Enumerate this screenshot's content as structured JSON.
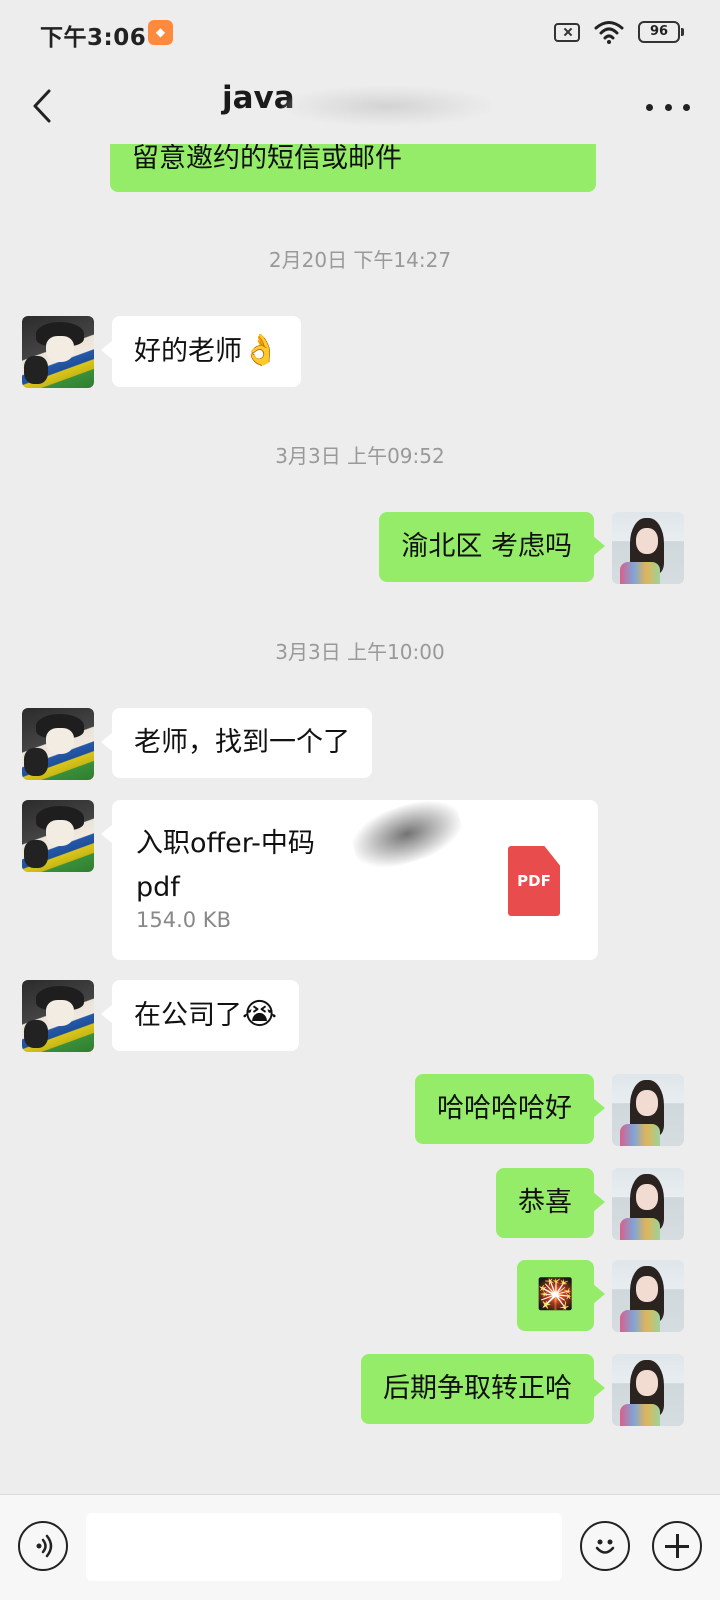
{
  "status_bar": {
    "time": "下午3:06",
    "battery": "96",
    "icons": [
      "app-notification-icon",
      "no-sim-icon",
      "wifi-icon",
      "battery-icon"
    ]
  },
  "header": {
    "title": "java",
    "back_icon": "chevron-left-icon",
    "more_icon": "more-dots-icon"
  },
  "messages": [
    {
      "from": "me",
      "type": "text",
      "text": "留意邀约的短信或邮件"
    },
    {
      "type": "time",
      "text": "2月20日 下午14:27"
    },
    {
      "from": "other",
      "type": "text",
      "text": "好的老师",
      "emoji": "👌"
    },
    {
      "type": "time",
      "text": "3月3日 上午09:52"
    },
    {
      "from": "me",
      "type": "text",
      "text": "渝北区 考虑吗"
    },
    {
      "type": "time",
      "text": "3月3日 上午10:00"
    },
    {
      "from": "other",
      "type": "text",
      "text": "老师，找到一个了"
    },
    {
      "from": "other",
      "type": "file",
      "file_name_line1": "入职offer-中码",
      "file_name_line2": "pdf",
      "file_size": "154.0 KB",
      "file_icon": "PDF"
    },
    {
      "from": "other",
      "type": "text",
      "text": "在公司了",
      "emoji": "😭"
    },
    {
      "from": "me",
      "type": "text",
      "text": "哈哈哈哈好"
    },
    {
      "from": "me",
      "type": "text",
      "text": "恭喜"
    },
    {
      "from": "me",
      "type": "emoji",
      "emoji": "🎇"
    },
    {
      "from": "me",
      "type": "text",
      "text": "后期争取转正哈"
    }
  ],
  "input_bar": {
    "value": "",
    "voice_icon": "voice-icon",
    "emoji_icon": "emoji-face-icon",
    "plus_icon": "plus-icon"
  },
  "colors": {
    "background": "#ededed",
    "my_bubble": "#95ec69",
    "their_bubble": "#ffffff",
    "timestamp": "#999999",
    "pdf_red": "#e84c4c"
  }
}
